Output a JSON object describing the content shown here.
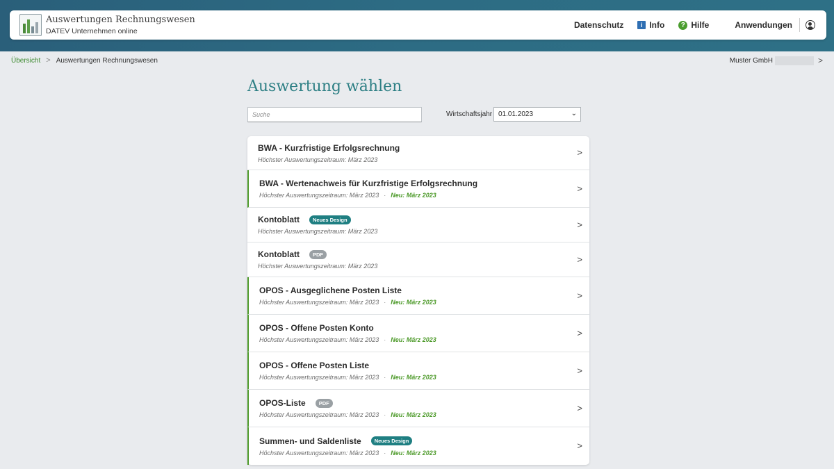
{
  "app": {
    "title": "Auswertungen Rechnungswesen",
    "subtitle": "DATEV Unternehmen online"
  },
  "nav": {
    "datenschutz": "Datenschutz",
    "info": "Info",
    "info_icon": "i",
    "hilfe": "Hilfe",
    "hilfe_icon": "?",
    "anwendungen": "Anwendungen"
  },
  "breadcrumb": {
    "home": "Übersicht",
    "current": "Auswertungen Rechnungswesen",
    "separator": ">"
  },
  "company": {
    "name": "Muster GmbH",
    "chevron": ">"
  },
  "main": {
    "title": "Auswertung wählen",
    "search_placeholder": "Suche",
    "year_label": "Wirtschaftsjahr",
    "year_value": "01.01.2023",
    "year_chevron": "⌄"
  },
  "colors": {
    "header_band": "#2d6c84",
    "title_teal": "#2d7f84",
    "new_green": "#4d9a2a",
    "badge_teal": "#1f7f82",
    "badge_gray": "#9aa0a4"
  },
  "items": [
    {
      "title": "BWA - Kurzfristige Erfolgsrechnung",
      "badge": "",
      "subtitle": "Höchster Auswertungszeitraum: März 2023",
      "new_text": "",
      "chevron": ">"
    },
    {
      "title": "BWA - Wertenachweis für Kurzfristige Erfolgsrechnung",
      "badge": "",
      "subtitle": "Höchster Auswertungszeitraum: März 2023",
      "new_text": "Neu: März 2023",
      "chevron": ">"
    },
    {
      "title": "Kontoblatt",
      "badge": "Neues Design",
      "subtitle": "Höchster Auswertungszeitraum: März 2023",
      "new_text": "",
      "chevron": ">"
    },
    {
      "title": "Kontoblatt",
      "badge": "PDF",
      "subtitle": "Höchster Auswertungszeitraum: März 2023",
      "new_text": "",
      "chevron": ">"
    },
    {
      "title": "OPOS - Ausgeglichene Posten Liste",
      "badge": "",
      "subtitle": "Höchster Auswertungszeitraum: März 2023",
      "new_text": "Neu: März 2023",
      "chevron": ">"
    },
    {
      "title": "OPOS - Offene Posten Konto",
      "badge": "",
      "subtitle": "Höchster Auswertungszeitraum: März 2023",
      "new_text": "Neu: März 2023",
      "chevron": ">"
    },
    {
      "title": "OPOS - Offene Posten Liste",
      "badge": "",
      "subtitle": "Höchster Auswertungszeitraum: März 2023",
      "new_text": "Neu: März 2023",
      "chevron": ">"
    },
    {
      "title": "OPOS-Liste",
      "badge": "PDF",
      "subtitle": "Höchster Auswertungszeitraum: März 2023",
      "new_text": "Neu: März 2023",
      "chevron": ">"
    },
    {
      "title": "Summen- und Saldenliste",
      "badge": "Neues Design",
      "subtitle": "Höchster Auswertungszeitraum: März 2023",
      "new_text": "Neu: März 2023",
      "chevron": ">"
    }
  ]
}
